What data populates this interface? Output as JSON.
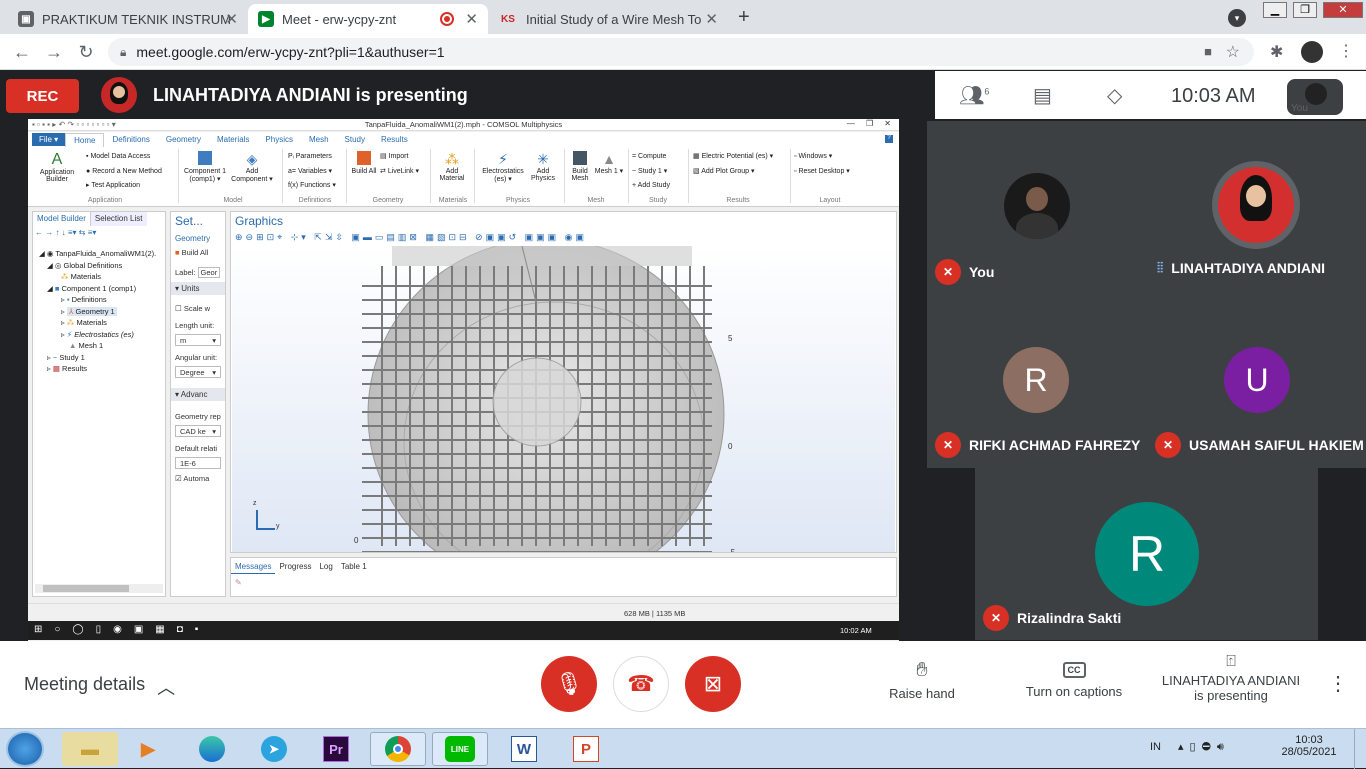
{
  "browser": {
    "tabs": [
      {
        "label": "PRAKTIKUM TEKNIK INSTRUMEN",
        "icon": "document-icon"
      },
      {
        "label": "Meet - erw-ycpy-znt",
        "icon": "meet-icon"
      },
      {
        "label": "Initial Study of a Wire Mesh Tom",
        "icon": "ks-icon",
        "favicon_text": "KS"
      }
    ],
    "new_tab": "+",
    "url": "meet.google.com/erw-ycpy-znt?pli=1&authuser=1"
  },
  "meet": {
    "rec_label": "REC",
    "presenting_text": "LINAHTADIYA ANDIANI is presenting",
    "people_count": "6",
    "time": "10:03  AM",
    "you_label": "You",
    "participants": [
      {
        "name": "You",
        "muted": true
      },
      {
        "name": "LINAHTADIYA ANDIANI",
        "muted": false
      },
      {
        "name": "RIFKI ACHMAD FAHREZY",
        "initial": "R",
        "color": "#8d6e63",
        "muted": true
      },
      {
        "name": "USAMAH SAIFUL HAKIEM",
        "initial": "U",
        "color": "#7b1fa2",
        "muted": true
      },
      {
        "name": "Rizalindra Sakti",
        "initial": "R",
        "color": "#00897b",
        "muted": true
      }
    ],
    "bottom": {
      "meeting_details": "Meeting details",
      "raise_hand": "Raise hand",
      "captions": "Turn on captions",
      "presenting_line1": "LINAHTADIYA ANDIANI",
      "presenting_line2": "is presenting"
    }
  },
  "comsol": {
    "title": "TanpaFluida_AnomaliWM1(2).mph - COMSOL Multiphysics",
    "menu_tabs": [
      "File ▾",
      "Home",
      "Definitions",
      "Geometry",
      "Materials",
      "Physics",
      "Mesh",
      "Study",
      "Results"
    ],
    "ribbon": {
      "app_builder": "Application Builder",
      "model_data_access": "Model Data Access",
      "record_method": "Record a New Method",
      "test_app": "Test Application",
      "group_application": "Application",
      "component": "Component 1 (comp1) ▾",
      "add_component": "Add Component ▾",
      "group_model": "Model",
      "parameters": "Parameters",
      "variables": "Variables ▾",
      "functions": "Functions ▾",
      "group_definitions": "Definitions",
      "build_all": "Build All",
      "import": "Import",
      "livelink": "LiveLink ▾",
      "group_geometry": "Geometry",
      "add_material": "Add Material",
      "group_materials": "Materials",
      "electrostatics": "Electrostatics (es) ▾",
      "add_physics": "Add Physics",
      "group_physics": "Physics",
      "build_mesh": "Build Mesh",
      "mesh1": "Mesh 1 ▾",
      "group_mesh": "Mesh",
      "compute": "Compute",
      "study1": "Study 1 ▾",
      "add_study": "Add Study",
      "group_study": "Study",
      "electric_potential": "Electric Potential (es) ▾",
      "add_plot_group": "Add Plot Group ▾",
      "group_results": "Results",
      "windows": "Windows ▾",
      "reset_desktop": "Reset Desktop ▾",
      "group_layout": "Layout"
    },
    "model_builder_tab": "Model Builder",
    "selection_list_tab": "Selection List",
    "tree": [
      "TanpaFluida_AnomaliWM1(2).",
      "Global Definitions",
      "Materials",
      "Component 1 (comp1)",
      "Definitions",
      "Geometry 1",
      "Materials",
      "Electrostatics (es)",
      "Mesh 1",
      "Study 1",
      "Results"
    ],
    "settings": {
      "title": "Set...",
      "subtitle": "Geometry",
      "build_all": "Build All",
      "label": "Label:",
      "label_value": "Geor",
      "units": "Units",
      "scale": "Scale w",
      "length_unit": "Length unit:",
      "length_value": "m",
      "angular_unit": "Angular unit:",
      "angular_value": "Degree",
      "advanced": "Advanc",
      "geom_rep": "Geometry rep",
      "geom_rep_value": "CAD ke",
      "default_rel": "Default relati",
      "default_rel_value": "1E-6",
      "automatic": "Automa"
    },
    "graphics_title": "Graphics",
    "axis_labels": [
      "5",
      "0",
      "-5",
      "0"
    ],
    "axis_triad": {
      "z": "z",
      "y": "y"
    },
    "bottom_tabs": [
      "Messages",
      "Progress",
      "Log",
      "Table 1"
    ],
    "status": "628 MB | 1135 MB",
    "inner_clock": "10:02 AM"
  },
  "os": {
    "apps": [
      "explorer",
      "media",
      "edge",
      "telegram",
      "Pr",
      "chrome",
      "LINE",
      "W",
      "P"
    ],
    "lang": "IN",
    "time": "10:03",
    "date": "28/05/2021"
  }
}
